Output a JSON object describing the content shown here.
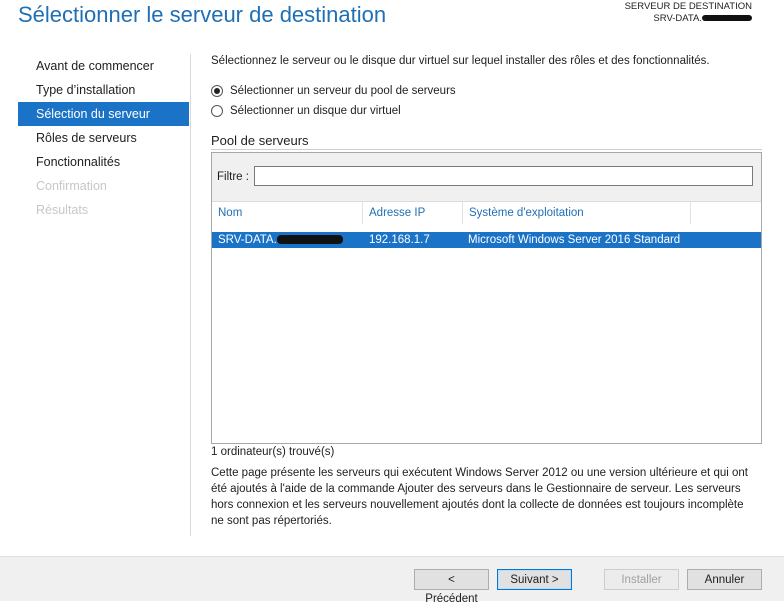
{
  "header": {
    "title": "Sélectionner le serveur de destination",
    "dest_label": "SERVEUR DE DESTINATION",
    "dest_value": "SRV-DATA."
  },
  "nav": {
    "items": [
      {
        "label": "Avant de commencer",
        "state": "normal"
      },
      {
        "label": "Type d’installation",
        "state": "normal"
      },
      {
        "label": "Sélection du serveur",
        "state": "active"
      },
      {
        "label": "Rôles de serveurs",
        "state": "normal"
      },
      {
        "label": "Fonctionnalités",
        "state": "normal"
      },
      {
        "label": "Confirmation",
        "state": "disabled"
      },
      {
        "label": "Résultats",
        "state": "disabled"
      }
    ]
  },
  "main": {
    "intro": "Sélectionnez le serveur ou le disque dur virtuel sur lequel installer des rôles et des fonctionnalités.",
    "options": [
      {
        "label": "Sélectionner un serveur du pool de serveurs",
        "checked": true
      },
      {
        "label": "Sélectionner un disque dur virtuel",
        "checked": false
      }
    ],
    "pool": {
      "heading": "Pool de serveurs",
      "filter_label": "Filtre :",
      "filter_value": "",
      "columns": [
        "Nom",
        "Adresse IP",
        "Système d'exploitation"
      ],
      "rows": [
        {
          "name": "SRV-DATA.",
          "ip": "192.168.1.7",
          "os": "Microsoft Windows Server 2016 Standard",
          "selected": true
        }
      ]
    },
    "count": "1 ordinateur(s) trouvé(s)",
    "description": "Cette page présente les serveurs qui exécutent Windows Server 2012 ou une version ultérieure et qui ont été ajoutés à l'aide de la commande Ajouter des serveurs dans le Gestionnaire de serveur. Les serveurs hors connexion et les serveurs nouvellement ajoutés dont la collecte de données est toujours incomplète ne sont pas répertoriés."
  },
  "footer": {
    "prev": "< Précédent",
    "next": "Suivant >",
    "install": "Installer",
    "cancel": "Annuler"
  },
  "colors": {
    "accent": "#1a73c6",
    "title": "#1f6fb5",
    "disabled_text": "#c7c7c7"
  }
}
